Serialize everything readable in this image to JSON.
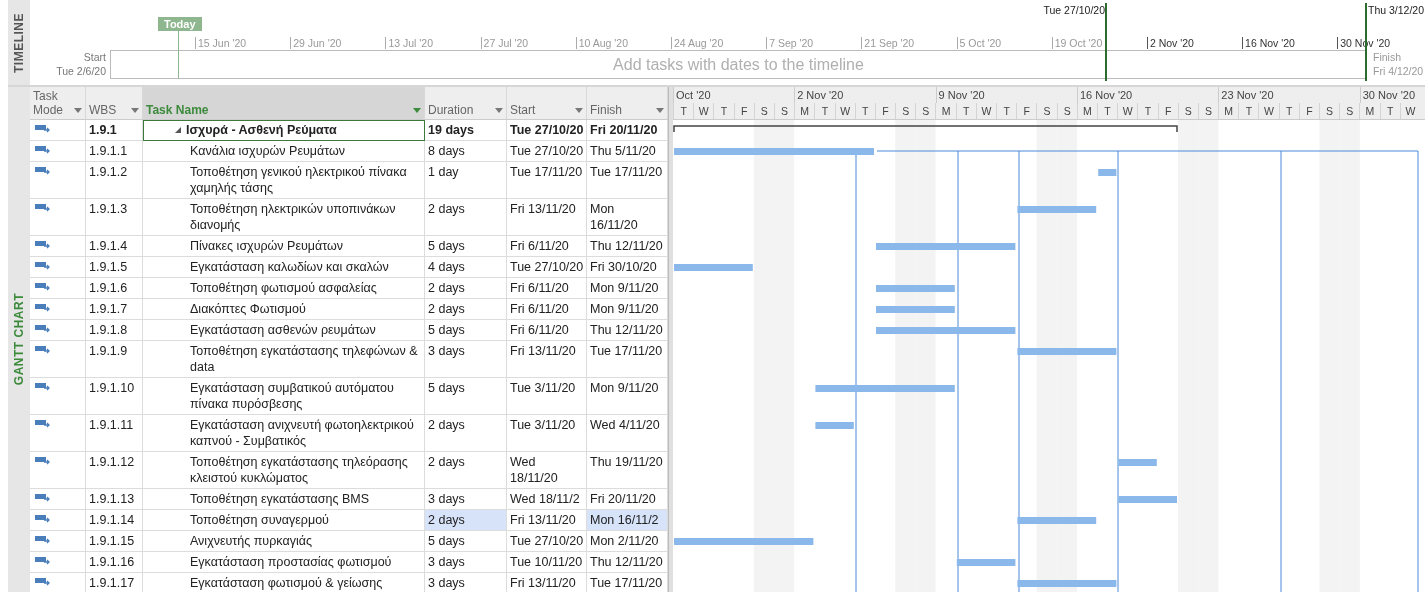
{
  "timeline": {
    "label": "TIMELINE",
    "today": "Today",
    "range_start": "Tue 27/10/20",
    "range_end": "Thu 3/12/20",
    "ticks": [
      {
        "label": "15 Jun '20",
        "in_range": false
      },
      {
        "label": "29 Jun '20",
        "in_range": false
      },
      {
        "label": "13 Jul '20",
        "in_range": false
      },
      {
        "label": "27 Jul '20",
        "in_range": false
      },
      {
        "label": "10 Aug '20",
        "in_range": false
      },
      {
        "label": "24 Aug '20",
        "in_range": false
      },
      {
        "label": "7 Sep '20",
        "in_range": false
      },
      {
        "label": "21 Sep '20",
        "in_range": false
      },
      {
        "label": "5 Oct '20",
        "in_range": false
      },
      {
        "label": "19 Oct '20",
        "in_range": false
      },
      {
        "label": "2 Nov '20",
        "in_range": true
      },
      {
        "label": "16 Nov '20",
        "in_range": true
      },
      {
        "label": "30 Nov '20",
        "in_range": true
      }
    ],
    "start_label": "Start",
    "start_date": "Tue 2/6/20",
    "message": "Add tasks with dates to the timeline",
    "finish_label": "Finish",
    "finish_date": "Fri 4/12/20"
  },
  "view_label": "GANTT CHART",
  "columns": [
    {
      "label": "Task Mode",
      "selected": false
    },
    {
      "label": "WBS",
      "selected": false
    },
    {
      "label": "Task Name",
      "selected": true
    },
    {
      "label": "Duration",
      "selected": false
    },
    {
      "label": "Start",
      "selected": false
    },
    {
      "label": "Finish",
      "selected": false
    }
  ],
  "rows": [
    {
      "wbs": "1.9.1",
      "name": "Ισχυρά - Ασθενή Ρεύματα",
      "duration": "19 days",
      "start": "Tue 27/10/20",
      "finish": "Fri 20/11/20",
      "kind": "summary",
      "selected": true,
      "changed": false
    },
    {
      "wbs": "1.9.1.1",
      "name": "Κανάλια ισχυρών Ρευμάτων",
      "duration": "8 days",
      "start": "Tue 27/10/20",
      "finish": "Thu 5/11/20",
      "kind": "task",
      "selected": false,
      "changed": false
    },
    {
      "wbs": "1.9.1.2",
      "name": "Τοποθέτηση γενικού ηλεκτρικού πίνακα χαμηλής τάσης",
      "duration": "1 day",
      "start": "Tue 17/11/20",
      "finish": "Tue 17/11/20",
      "kind": "task",
      "selected": false,
      "changed": false
    },
    {
      "wbs": "1.9.1.3",
      "name": "Τοποθέτηση ηλεκτρικών υποπινάκων διανομής",
      "duration": "2 days",
      "start": "Fri 13/11/20",
      "finish": "Mon 16/11/20",
      "kind": "task",
      "selected": false,
      "changed": false
    },
    {
      "wbs": "1.9.1.4",
      "name": "Πίνακες ισχυρών Ρευμάτων",
      "duration": "5 days",
      "start": "Fri 6/11/20",
      "finish": "Thu 12/11/20",
      "kind": "task",
      "selected": false,
      "changed": false
    },
    {
      "wbs": "1.9.1.5",
      "name": "Εγκατάσταση καλωδίων και σκαλών",
      "duration": "4 days",
      "start": "Tue 27/10/20",
      "finish": "Fri 30/10/20",
      "kind": "task",
      "selected": false,
      "changed": false
    },
    {
      "wbs": "1.9.1.6",
      "name": "Τοποθέτηση φωτισμού ασφαλείας",
      "duration": "2 days",
      "start": "Fri 6/11/20",
      "finish": "Mon 9/11/20",
      "kind": "task",
      "selected": false,
      "changed": false
    },
    {
      "wbs": "1.9.1.7",
      "name": "Διακόπτες Φωτισμού",
      "duration": "2 days",
      "start": "Fri 6/11/20",
      "finish": "Mon 9/11/20",
      "kind": "task",
      "selected": false,
      "changed": false
    },
    {
      "wbs": "1.9.1.8",
      "name": "Εγκατάσταση ασθενών ρευμάτων",
      "duration": "5 days",
      "start": "Fri 6/11/20",
      "finish": "Thu 12/11/20",
      "kind": "task",
      "selected": false,
      "changed": false
    },
    {
      "wbs": "1.9.1.9",
      "name": "Τοποθέτηση εγκατάστασης τηλεφώνων & data",
      "duration": "3 days",
      "start": "Fri 13/11/20",
      "finish": "Tue 17/11/20",
      "kind": "task",
      "selected": false,
      "changed": false
    },
    {
      "wbs": "1.9.1.10",
      "name": "Εγκατάσταση συμβατικού αυτόματου πίνακα πυρόσβεσης",
      "duration": "5 days",
      "start": "Tue 3/11/20",
      "finish": "Mon 9/11/20",
      "kind": "task",
      "selected": false,
      "changed": false
    },
    {
      "wbs": "1.9.1.11",
      "name": "Εγκατάσταση ανιχνευτή φωτοηλεκτρικού καπνού - Συμβατικός",
      "duration": "2 days",
      "start": "Tue 3/11/20",
      "finish": "Wed 4/11/20",
      "kind": "task",
      "selected": false,
      "changed": false
    },
    {
      "wbs": "1.9.1.12",
      "name": "Τοποθέτηση εγκατάστασης τηλεόρασης κλειστού κυκλώματος",
      "duration": "2 days",
      "start": "Wed 18/11/20",
      "finish": "Thu 19/11/20",
      "kind": "task",
      "selected": false,
      "changed": false
    },
    {
      "wbs": "1.9.1.13",
      "name": "Τοποθέτηση εγκατάστασης BMS",
      "duration": "3 days",
      "start": "Wed 18/11/2",
      "finish": "Fri 20/11/20",
      "kind": "task",
      "selected": false,
      "changed": false
    },
    {
      "wbs": "1.9.1.14",
      "name": "Τοποθέτηση συναγερμού",
      "duration": "2 days",
      "start": "Fri 13/11/20",
      "finish": "Mon 16/11/2",
      "kind": "task",
      "selected": false,
      "changed": true
    },
    {
      "wbs": "1.9.1.15",
      "name": "Ανιχνευτής πυρκαγιάς",
      "duration": "5 days",
      "start": "Tue 27/10/20",
      "finish": "Mon 2/11/20",
      "kind": "task",
      "selected": false,
      "changed": false
    },
    {
      "wbs": "1.9.1.16",
      "name": "Εγκατάσταση προστασίας φωτισμού",
      "duration": "3 days",
      "start": "Tue 10/11/20",
      "finish": "Thu 12/11/20",
      "kind": "task",
      "selected": false,
      "changed": false
    },
    {
      "wbs": "1.9.1.17",
      "name": "Εγκατάσταση φωτισμού & γείωσης",
      "duration": "3 days",
      "start": "Fri 13/11/20",
      "finish": "Tue 17/11/20",
      "kind": "task",
      "selected": false,
      "changed": false
    }
  ],
  "timescale": {
    "weeks": [
      {
        "label": "Oct '20",
        "days": [
          "T",
          "W",
          "T",
          "F",
          "S",
          "S"
        ]
      },
      {
        "label": "2 Nov '20",
        "days": [
          "M",
          "T",
          "W",
          "T",
          "F",
          "S",
          "S"
        ]
      },
      {
        "label": "9 Nov '20",
        "days": [
          "M",
          "T",
          "W",
          "T",
          "F",
          "S",
          "S"
        ]
      },
      {
        "label": "16 Nov '20",
        "days": [
          "M",
          "T",
          "W",
          "T",
          "F",
          "S",
          "S"
        ]
      },
      {
        "label": "23 Nov '20",
        "days": [
          "M",
          "T",
          "W",
          "T",
          "F",
          "S",
          "S"
        ]
      },
      {
        "label": "30 Nov '20",
        "days": [
          "M",
          "T",
          "W"
        ]
      }
    ]
  }
}
